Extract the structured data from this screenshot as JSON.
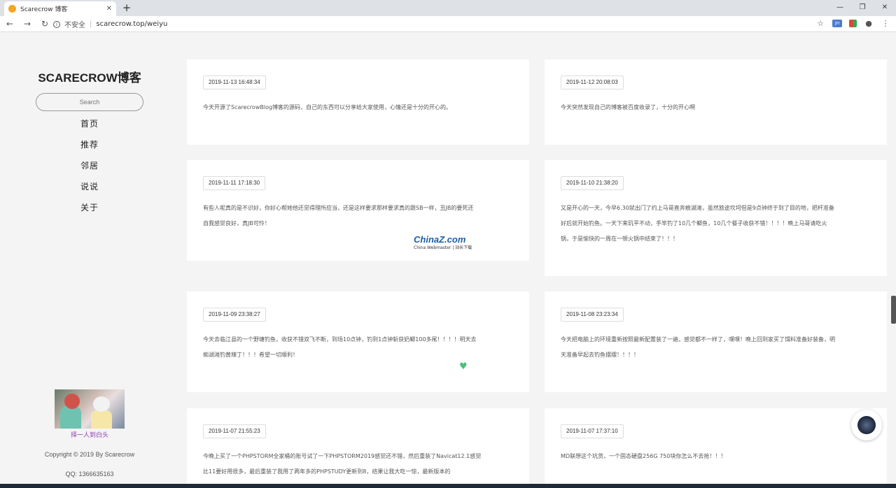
{
  "browser": {
    "tab_title": "Scarecrow 博客",
    "tab_close": "✕",
    "new_tab": "+",
    "win_min": "—",
    "win_max": "❐",
    "win_close": "✕",
    "back": "←",
    "forward": "→",
    "reload": "↻",
    "insecure_label": "不安全",
    "url": "scarecrow.top/weiyu",
    "star": "☆",
    "ext1": "JH",
    "profile": "●",
    "menu": "⋮",
    "info_glyph": "i"
  },
  "sidebar": {
    "brand": "SCARECROW博客",
    "search_placeholder": "Search",
    "menu": [
      "首页",
      "推荐",
      "邻居",
      "说说",
      "关于"
    ],
    "avatar_caption": "择一人到白头",
    "copyright": "Copyright © 2019 By Scarecrow",
    "qq": "QQ:  1366635163"
  },
  "posts": [
    {
      "date": "2019-11-13 16:48:34",
      "lines": [
        "今天开源了ScarecrowBlog博客的源码，自己的东西可以分享给大家使用，心情还是十分的开心的。"
      ]
    },
    {
      "date": "2019-11-12 20:08:03",
      "lines": [
        "今天突然发现自己的博客被百度收录了，十分的开心啊"
      ]
    },
    {
      "date": "2019-11-11 17:18:30",
      "lines": [
        "有些人呢真的是不识好，你好心帮她他还觉得理所应当，还是这样要求那样要求真的跟SB一样，丑JB的要死还",
        "自我感觉良好，真JB可怜！"
      ]
    },
    {
      "date": "2019-11-10 21:38:20",
      "lines": [
        "又是开心的一天，今早6.30就出门了约上马哥直奔痕湖滩，虽然旅途坎坷但是9点钟终于到了目的地，把杆准备",
        "好后就开始钓鱼。一天下来玑平不动，手竿钓了10几个鲫鱼，10几个餐子收获不错！！！！晚上马哥请吃火",
        "锅，于是愉快的一周在一顿火锅中结束了！！！"
      ]
    },
    {
      "date": "2019-11-09 23:38:27",
      "lines": [
        "今天去临江县的一个野塘钓鱼，收获不错双飞不断，到场10点钟，钓到1点钟斩获奶鲫100多尾！！！！明天去",
        "痴湖滩钓黄辣丁！！！希望一切顺利！"
      ]
    },
    {
      "date": "2019-11-08 23:23:34",
      "lines": [
        "今天把电脑上的环境重新按照最新配置装了一遍，感觉都不一样了，嘿嘿！晚上回到家买了饵料准备好装备，明",
        "天准备早起去钓鱼摆摆！！！！"
      ]
    },
    {
      "date": "2019-11-07 21:55:23",
      "lines": [
        "今晚上买了一个PHPSTORM全家桶的账号试了一下PHPSTORM2019感觉还不错，然后重装了Navicat12.1感觉",
        "比11要好用很多，最后重装了我用了两年多的PHPSTUDY更新到8，结果让我大吃一惊，最新版本的"
      ]
    },
    {
      "date": "2019-11-07 17:37:10",
      "lines": [
        "MD联想这个坑货，一个固态硬盘256G 750块你怎么不去抢！！！"
      ]
    }
  ],
  "watermark": {
    "brand": "ChinaZ.com",
    "tagline": "China Webmaster | 站长下载"
  },
  "heart_icon": "♥"
}
